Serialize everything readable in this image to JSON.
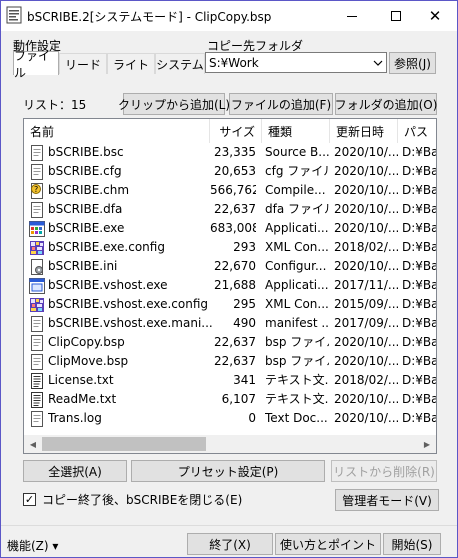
{
  "window": {
    "title": "bSCRIBE.2[システムモード] - ClipCopy.bsp",
    "close_glyph": "✕"
  },
  "labels": {
    "behavior": "動作設定",
    "destination": "コピー先フォルダ",
    "list_count": "リスト：15"
  },
  "tabs": [
    {
      "label": "ファイル",
      "active": true
    },
    {
      "label": "リード",
      "active": false
    },
    {
      "label": "ライト",
      "active": false
    },
    {
      "label": "システム",
      "active": false
    }
  ],
  "destination": {
    "value": "S:¥Work",
    "browse_label": "参照(J)"
  },
  "add_buttons": {
    "clipboard": "クリップから追加(L)",
    "file": "ファイルの追加(F)",
    "folder": "フォルダの追加(O)"
  },
  "list": {
    "columns": [
      "名前",
      "サイズ",
      "種類",
      "更新日時",
      "パス"
    ],
    "rows": [
      {
        "name": "bSCRIBE.bsc",
        "size": "23,335",
        "type": "Source B...",
        "date": "2020/10/...",
        "path": "D:¥Bac",
        "icon": "document-icon"
      },
      {
        "name": "bSCRIBE.cfg",
        "size": "20,653",
        "type": "cfg ファイル",
        "date": "2020/10/...",
        "path": "D:¥Bac",
        "icon": "document-icon"
      },
      {
        "name": "bSCRIBE.chm",
        "size": "566,762",
        "type": "Compile...",
        "date": "2020/10/...",
        "path": "D:¥Bac",
        "icon": "help-file-icon"
      },
      {
        "name": "bSCRIBE.dfa",
        "size": "22,637",
        "type": "dfa ファイル",
        "date": "2020/10/...",
        "path": "D:¥Bac",
        "icon": "document-icon"
      },
      {
        "name": "bSCRIBE.exe",
        "size": "683,008",
        "type": "Applicati...",
        "date": "2020/10/...",
        "path": "D:¥Bac",
        "icon": "app-icon"
      },
      {
        "name": "bSCRIBE.exe.config",
        "size": "293",
        "type": "XML Con...",
        "date": "2018/02/...",
        "path": "D:¥Bac",
        "icon": "config-icon"
      },
      {
        "name": "bSCRIBE.ini",
        "size": "22,670",
        "type": "Configur...",
        "date": "2020/10/...",
        "path": "D:¥Bac",
        "icon": "settings-file-icon"
      },
      {
        "name": "bSCRIBE.vshost.exe",
        "size": "21,688",
        "type": "Applicati...",
        "date": "2017/11/...",
        "path": "D:¥Bac",
        "icon": "exe-icon"
      },
      {
        "name": "bSCRIBE.vshost.exe.config",
        "size": "295",
        "type": "XML Con...",
        "date": "2015/09/...",
        "path": "D:¥Bac",
        "icon": "config-icon"
      },
      {
        "name": "bSCRIBE.vshost.exe.mani...",
        "size": "490",
        "type": "manifest ...",
        "date": "2017/09/...",
        "path": "D:¥Bac",
        "icon": "document-icon"
      },
      {
        "name": "ClipCopy.bsp",
        "size": "22,637",
        "type": "bsp ファイル",
        "date": "2020/10/...",
        "path": "D:¥Bac",
        "icon": "document-icon"
      },
      {
        "name": "ClipMove.bsp",
        "size": "22,637",
        "type": "bsp ファイル",
        "date": "2020/10/...",
        "path": "D:¥Bac",
        "icon": "document-icon"
      },
      {
        "name": "License.txt",
        "size": "341",
        "type": "テキスト文...",
        "date": "2018/02/...",
        "path": "D:¥Bac",
        "icon": "text-file-icon"
      },
      {
        "name": "ReadMe.txt",
        "size": "6,107",
        "type": "テキスト文...",
        "date": "2020/10/...",
        "path": "D:¥Bac",
        "icon": "text-file-icon"
      },
      {
        "name": "Trans.log",
        "size": "0",
        "type": "Text Doc...",
        "date": "2020/10/...",
        "path": "D:¥Bac",
        "icon": "document-icon"
      }
    ]
  },
  "bottom_buttons": {
    "select_all": "全選択(A)",
    "preset": "プリセット設定(P)",
    "remove": "リストから削除(R)"
  },
  "options": {
    "close_after_copy_label": "コピー終了後、bSCRIBEを閉じる(E)",
    "close_after_copy_checked": true,
    "check_glyph": "✓",
    "admin_mode_label": "管理者モード(V)"
  },
  "footer": {
    "function_menu": "機能(Z) ▾",
    "exit": "終了(X)",
    "howto": "使い方とポイント",
    "start": "開始(S)"
  },
  "colors": {
    "accent_border": "#5b57c7",
    "window_bg": "#f0f0f0",
    "button_bg": "#e1e1e1"
  }
}
